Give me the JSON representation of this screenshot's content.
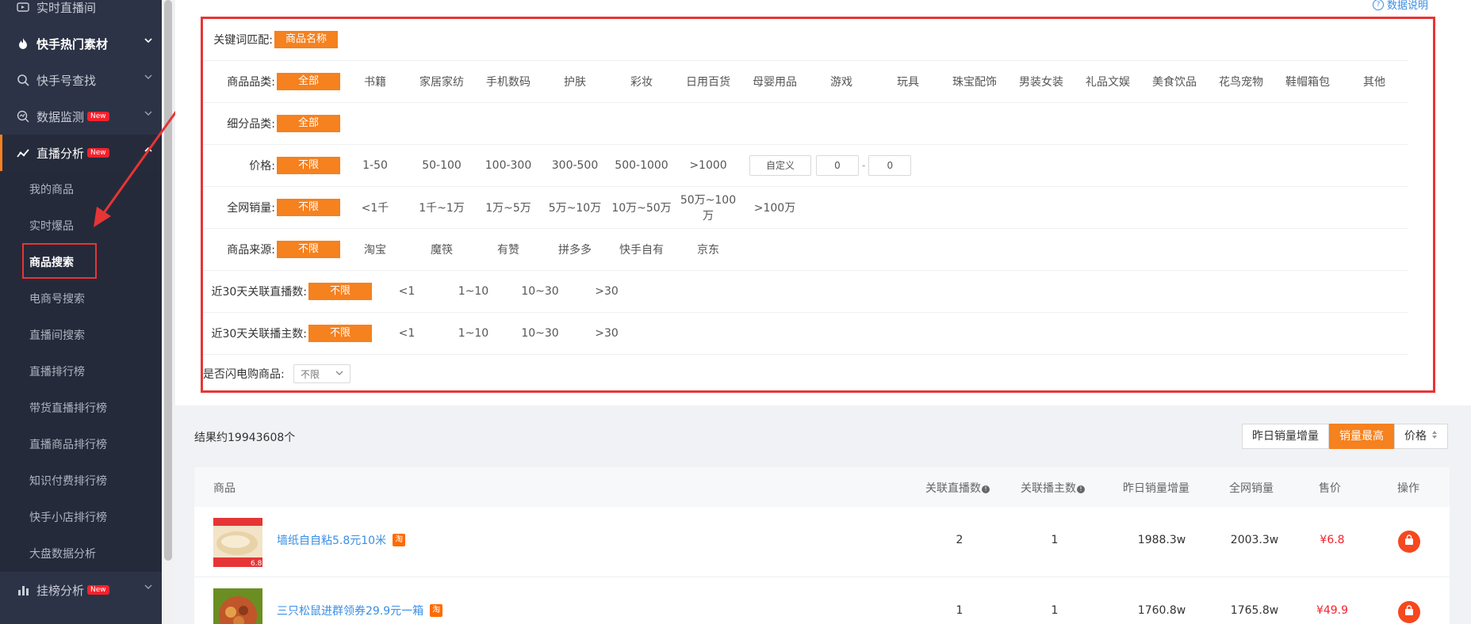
{
  "sidebar": {
    "items": [
      {
        "label": "实时直播间",
        "icon": "tv-icon",
        "type": "plain"
      },
      {
        "label": "快手热门素材",
        "icon": "fire-icon",
        "type": "bold"
      },
      {
        "label": "快手号查找",
        "icon": "search-icon",
        "type": "plain"
      },
      {
        "label": "数据监测",
        "icon": "monitor-icon",
        "badge": "New",
        "type": "plain"
      },
      {
        "label": "直播分析",
        "icon": "chart-line-icon",
        "badge": "New",
        "type": "active"
      },
      {
        "label": "挂榜分析",
        "icon": "bar-chart-icon",
        "badge": "New",
        "type": "plain"
      }
    ],
    "sub_items": [
      "我的商品",
      "实时爆品",
      "商品搜索",
      "电商号搜索",
      "直播间搜索",
      "直播排行榜",
      "带货直播排行榜",
      "直播商品排行榜",
      "知识付费排行榜",
      "快手小店排行榜",
      "大盘数据分析"
    ]
  },
  "header": {
    "data_help": "数据说明"
  },
  "filters": {
    "keyword": {
      "label": "关键词匹配:",
      "options": [
        "商品名称"
      ]
    },
    "category": {
      "label": "商品品类:",
      "options": [
        "全部",
        "书籍",
        "家居家纺",
        "手机数码",
        "护肤",
        "彩妆",
        "日用百货",
        "母婴用品",
        "游戏",
        "玩具",
        "珠宝配饰",
        "男装女装",
        "礼品文娱",
        "美食饮品",
        "花鸟宠物",
        "鞋帽箱包",
        "其他"
      ]
    },
    "subcategory": {
      "label": "细分品类:",
      "options": [
        "全部"
      ]
    },
    "price": {
      "label": "价格:",
      "options": [
        "不限",
        "1-50",
        "50-100",
        "100-300",
        "300-500",
        "500-1000",
        ">1000"
      ],
      "custom_label": "自定义",
      "min_value": "0",
      "max_value": "0",
      "dash": "-"
    },
    "sales": {
      "label": "全网销量:",
      "options": [
        "不限",
        "<1千",
        "1千~1万",
        "1万~5万",
        "5万~10万",
        "10万~50万",
        "50万~100万",
        ">100万"
      ]
    },
    "source": {
      "label": "商品来源:",
      "options": [
        "不限",
        "淘宝",
        "魔筷",
        "有赞",
        "拼多多",
        "快手自有",
        "京东"
      ]
    },
    "live_count": {
      "label": "近30天关联直播数:",
      "options": [
        "不限",
        "<1",
        "1~10",
        "10~30",
        ">30"
      ]
    },
    "anchor_count": {
      "label": "近30天关联播主数:",
      "options": [
        "不限",
        "<1",
        "1~10",
        "10~30",
        ">30"
      ]
    },
    "flash": {
      "label": "是否闪电购商品:",
      "value": "不限"
    }
  },
  "results": {
    "count_text": "结果约19943608个",
    "sort": [
      "昨日销量增量",
      "销量最高",
      "价格"
    ],
    "columns": [
      "商品",
      "关联直播数",
      "关联播主数",
      "昨日销量增量",
      "全网销量",
      "售价",
      "操作"
    ],
    "rows": [
      {
        "name": "墙纸自自粘5.8元10米",
        "platform": "淘",
        "live": "2",
        "anchors": "1",
        "yesterday": "1988.3w",
        "total": "2003.3w",
        "price": "¥6.8",
        "img_price": "6.8"
      },
      {
        "name": "三只松鼠进群领券29.9元一箱",
        "platform": "淘",
        "live": "1",
        "anchors": "1",
        "yesterday": "1760.8w",
        "total": "1765.8w",
        "price": "¥49.9",
        "img_price": ""
      }
    ]
  },
  "colors": {
    "accent": "#f5811f",
    "highlight": "#e63536",
    "link": "#3a8ee6",
    "price": "#f5222d",
    "sidebar_bg": "#2d3346"
  }
}
